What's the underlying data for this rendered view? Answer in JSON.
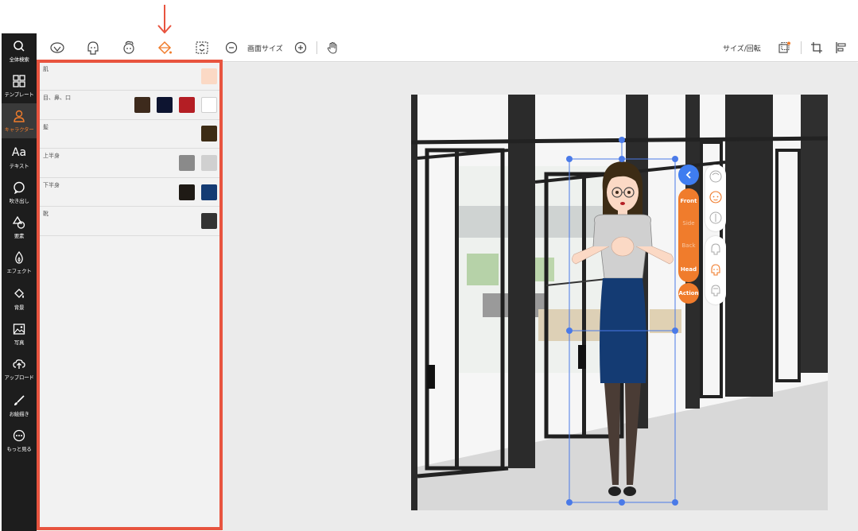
{
  "nav": {
    "items": [
      {
        "label": "全体検索",
        "icon": "search-icon"
      },
      {
        "label": "テンプレート",
        "icon": "grid-icon"
      },
      {
        "label": "キャラクター",
        "icon": "person-icon",
        "active": true
      },
      {
        "label": "テキスト",
        "icon": "text-icon",
        "glyph": "Aa"
      },
      {
        "label": "吹き出し",
        "icon": "speech-bubble-icon"
      },
      {
        "label": "要素",
        "icon": "shapes-icon"
      },
      {
        "label": "エフェクト",
        "icon": "flame-icon"
      },
      {
        "label": "背景",
        "icon": "paint-bucket-icon"
      },
      {
        "label": "写真",
        "icon": "photo-icon"
      },
      {
        "label": "アップロード",
        "icon": "upload-cloud-icon"
      },
      {
        "label": "お絵描き",
        "icon": "brush-icon"
      },
      {
        "label": "もっと見る",
        "icon": "more-icon"
      }
    ]
  },
  "toolbar": {
    "tabs": [
      "face-icon",
      "head-icon",
      "hair-icon",
      "color-fill-icon",
      "swap-icon"
    ],
    "canvas_size_label": "画面サイズ",
    "size_rotate_label": "サイズ/回転"
  },
  "panel": {
    "rows": [
      {
        "label": "肌",
        "colors": [
          "#fbd9c5"
        ]
      },
      {
        "label": "目、鼻、口",
        "colors": [
          "#3d2a1c",
          "#0d1430",
          "#b41e24",
          "#ffffff"
        ]
      },
      {
        "label": "髪",
        "colors": [
          "#3d2c15"
        ]
      },
      {
        "label": "上半身",
        "colors": [
          "#8a8a8a",
          "#d0d0d0"
        ]
      },
      {
        "label": "下半身",
        "colors": [
          "#1f1a15",
          "#143b73"
        ]
      },
      {
        "label": "靴",
        "colors": [
          "#333333"
        ]
      }
    ]
  },
  "pose": {
    "front": "Front",
    "side": "Side",
    "back": "Back",
    "head": "Head",
    "action": "Action"
  },
  "colors": {
    "accent": "#f07c2c",
    "highlight": "#e8543f",
    "selection": "#3f7df0"
  }
}
